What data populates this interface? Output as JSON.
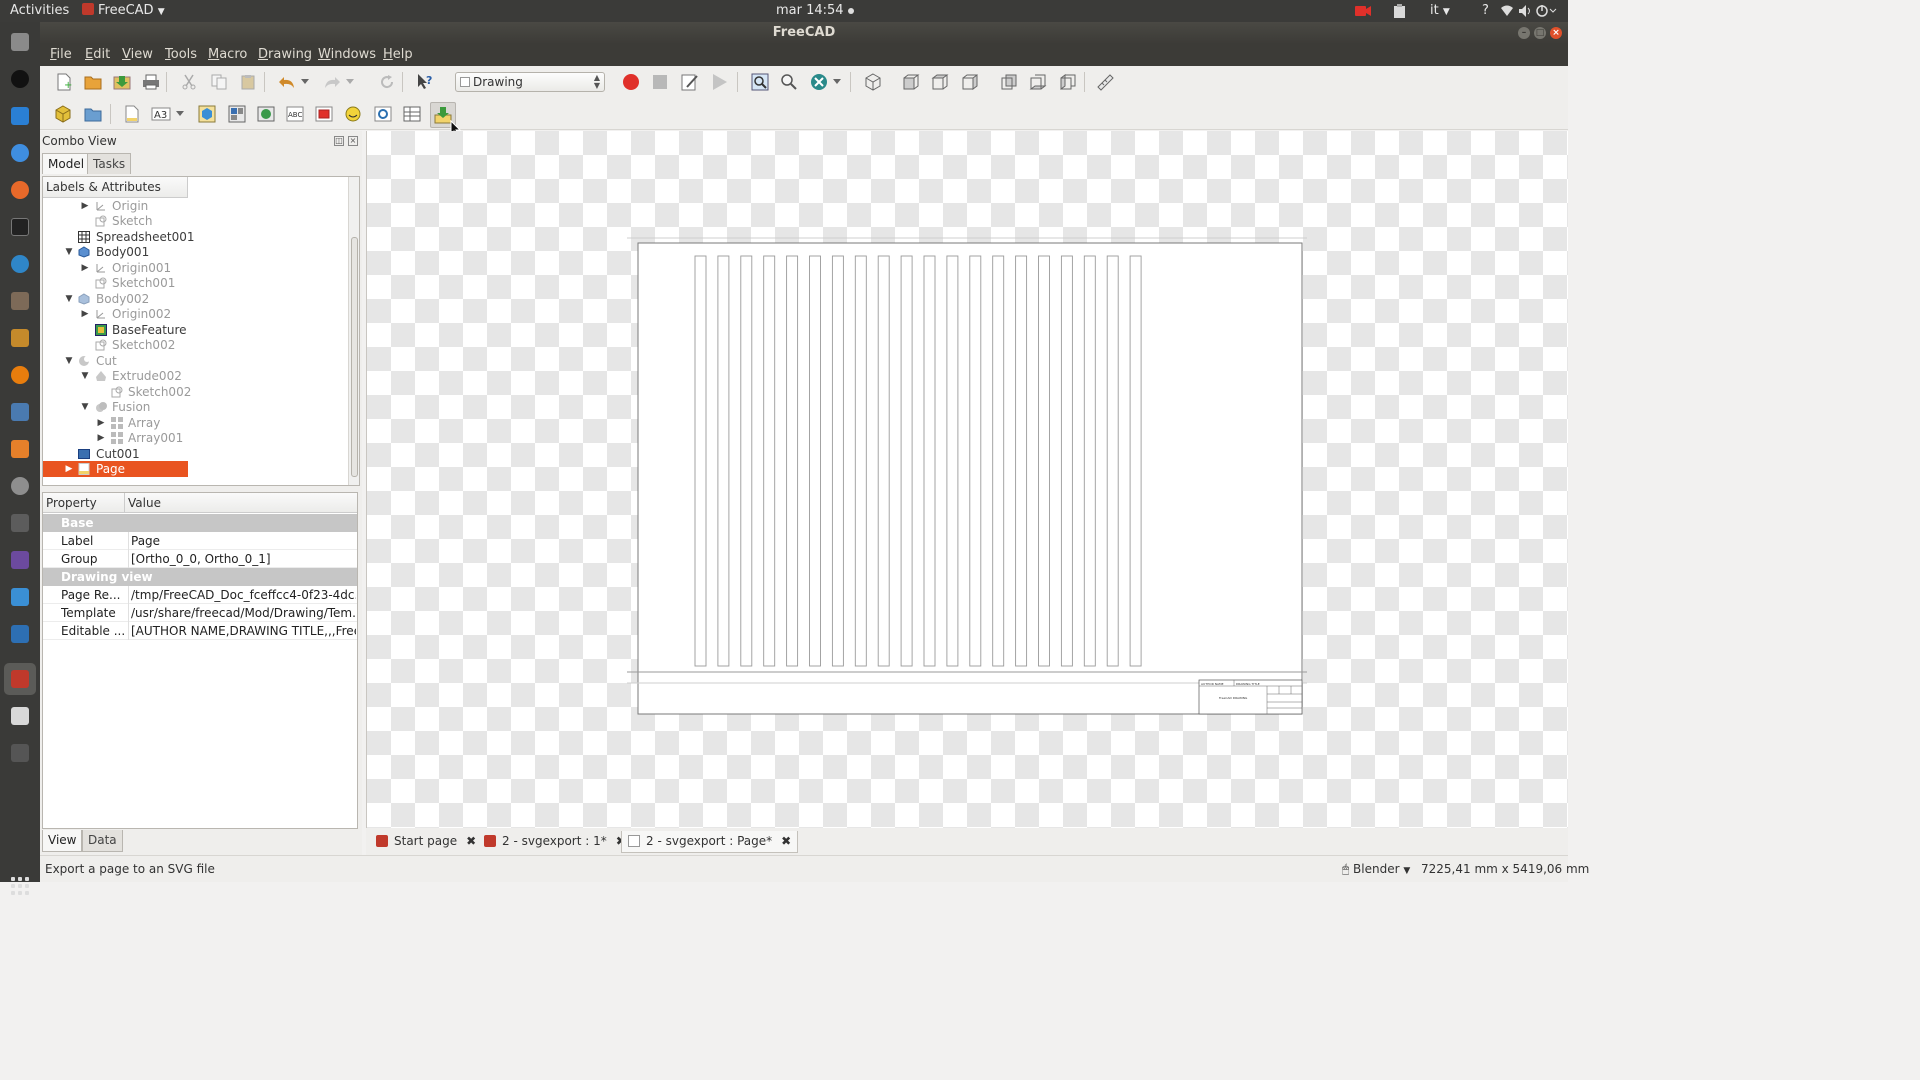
{
  "system": {
    "activities": "Activities",
    "app_menu": "FreeCAD",
    "clock": "mar 14:54",
    "keyboard_layout": "it",
    "help_glyph": "?"
  },
  "window": {
    "title": "FreeCAD"
  },
  "menubar": {
    "items": [
      {
        "mnemonic": "F",
        "rest": "ile"
      },
      {
        "mnemonic": "E",
        "rest": "dit"
      },
      {
        "mnemonic": "V",
        "rest": "iew"
      },
      {
        "mnemonic": "T",
        "rest": "ools"
      },
      {
        "mnemonic": "M",
        "rest": "acro"
      },
      {
        "mnemonic": "D",
        "rest": "rawing"
      },
      {
        "mnemonic": "W",
        "rest": "indows"
      },
      {
        "mnemonic": "H",
        "rest": "elp"
      }
    ]
  },
  "toolbar": {
    "workbench": "Drawing"
  },
  "combo": {
    "title": "Combo View",
    "tabs": [
      "Model",
      "Tasks"
    ],
    "tree_header": "Labels & Attributes",
    "tree": [
      {
        "label": "Origin",
        "dim": true
      },
      {
        "label": "Sketch",
        "dim": true
      },
      {
        "label": "Spreadsheet001",
        "dim": false
      },
      {
        "label": "Body001",
        "dim": false
      },
      {
        "label": "Origin001",
        "dim": true
      },
      {
        "label": "Sketch001",
        "dim": true
      },
      {
        "label": "Body002",
        "dim": true
      },
      {
        "label": "Origin002",
        "dim": true
      },
      {
        "label": "BaseFeature",
        "dim": false
      },
      {
        "label": "Sketch002",
        "dim": true
      },
      {
        "label": "Cut",
        "dim": true
      },
      {
        "label": "Extrude002",
        "dim": true
      },
      {
        "label": "Sketch002",
        "dim": true
      },
      {
        "label": "Fusion",
        "dim": true
      },
      {
        "label": "Array",
        "dim": true
      },
      {
        "label": "Array001",
        "dim": true
      },
      {
        "label": "Cut001",
        "dim": false
      },
      {
        "label": "Page",
        "selected": true
      }
    ],
    "props_header": {
      "property": "Property",
      "value": "Value"
    },
    "groups": [
      {
        "name": "Base",
        "rows": [
          {
            "name": "Label",
            "value": "Page"
          },
          {
            "name": "Group",
            "value": "[Ortho_0_0, Ortho_0_1]"
          }
        ]
      },
      {
        "name": "Drawing view",
        "rows": [
          {
            "name": "Page Re...",
            "value": "/tmp/FreeCAD_Doc_fceffcc4-0f23-4dc..."
          },
          {
            "name": "Template",
            "value": "/usr/share/freecad/Mod/Drawing/Tem..."
          },
          {
            "name": "Editable ...",
            "value": "[AUTHOR NAME,DRAWING TITLE,,,Free..."
          }
        ]
      }
    ],
    "bottom_tabs": [
      "View",
      "Data"
    ]
  },
  "titleblock": {
    "author": "AUTHOR NAME",
    "drawing_title": "DRAWING TITLE",
    "subtitle": "FreeCAD DRAWING"
  },
  "doc_tabs": [
    "Start page",
    "2 - svgexport : 1*",
    "2 - svgexport : Page*"
  ],
  "status": {
    "message": "Export a page to an SVG file",
    "nav_style": "Blender",
    "dimensions": "7225,41 mm x 5419,06 mm"
  },
  "colors": {
    "selection": "#e95420",
    "record": "#e0302a",
    "drawing_line": "#9a9a9a"
  }
}
